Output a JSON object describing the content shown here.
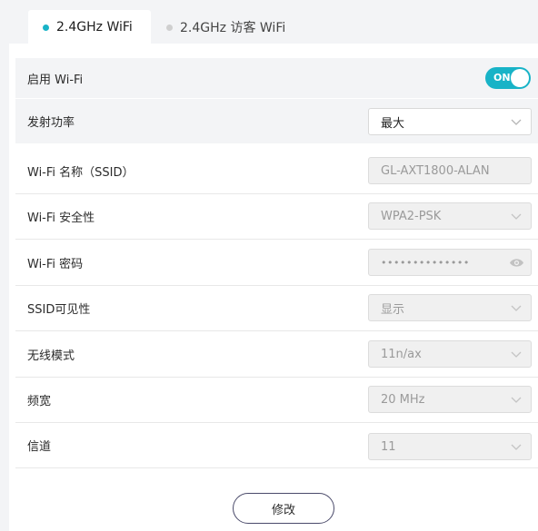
{
  "tabs": [
    {
      "label": "2.4GHz WiFi",
      "active": true
    },
    {
      "label": "2.4GHz 访客 WiFi",
      "active": false
    }
  ],
  "accent_color": "#18b3c7",
  "rows": {
    "enable_wifi": {
      "label": "启用 Wi-Fi",
      "toggle_text": "ON",
      "state": "on"
    },
    "tx_power": {
      "label": "发射功率",
      "value": "最大"
    },
    "ssid": {
      "label": "Wi-Fi 名称（SSID）",
      "value": "GL-AXT1800-ALAN"
    },
    "security": {
      "label": "Wi-Fi 安全性",
      "value": "WPA2-PSK"
    },
    "password": {
      "label": "Wi-Fi 密码",
      "value": "••••••••••••••"
    },
    "ssid_visibility": {
      "label": "SSID可见性",
      "value": "显示"
    },
    "wireless_mode": {
      "label": "无线模式",
      "value": "11n/ax"
    },
    "bandwidth": {
      "label": "频宽",
      "value": "20 MHz"
    },
    "channel": {
      "label": "信道",
      "value": "11"
    }
  },
  "actions": {
    "modify_label": "修改"
  },
  "icons": {
    "select_arrow": "chevron-down-icon",
    "reveal_password": "eye-icon"
  }
}
